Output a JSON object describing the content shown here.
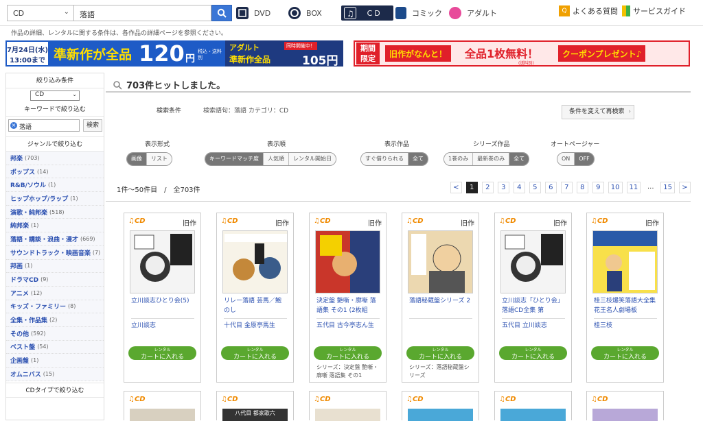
{
  "header": {
    "category_select": "CD",
    "search_value": "落語",
    "nav": [
      {
        "label": "DVD"
      },
      {
        "label": "BOX"
      },
      {
        "label": "ＣＤ"
      },
      {
        "label": "コミック"
      },
      {
        "label": "アダルト"
      }
    ],
    "faq": "よくある質問",
    "guide": "サービスガイド"
  },
  "notice": "作品の詳細、レンタルに関する条件は、各作品の詳細ページを参照ください。",
  "banner1": {
    "date": "7月24日(水)",
    "time": "13:00まで",
    "main": "準新作が全品",
    "price": "120",
    "yen": "円",
    "tax": "税込・送料別",
    "adult": "アダルト",
    "now": "同時開催中！",
    "adult_main": "準新作全品",
    "adult_price": "105円"
  },
  "banner2": {
    "tag1": "期間",
    "tag2": "限定",
    "text1": "旧作がなんと！",
    "text2": "全品1枚無料！",
    "text3": "(送料別)",
    "text4": "クーポンプレゼント♪"
  },
  "sidebar": {
    "filter_title": "絞り込み条件",
    "select": "CD",
    "keyword_title": "キーワードで絞り込む",
    "keyword_value": "落語",
    "keyword_button": "検索",
    "genre_title": "ジャンルで絞り込む",
    "genres": [
      {
        "label": "邦楽",
        "count": "(703)"
      },
      {
        "label": "ポップス",
        "count": "(14)"
      },
      {
        "label": "R&B/ソウル",
        "count": "(1)"
      },
      {
        "label": "ヒップホップ/ラップ",
        "count": "(1)"
      },
      {
        "label": "演歌・純邦楽",
        "count": "(518)"
      },
      {
        "label": "純邦楽",
        "count": "(1)"
      },
      {
        "label": "落語・講談・浪曲・漫才",
        "count": "(669)"
      },
      {
        "label": "サウンドトラック・映画音楽",
        "count": "(7)"
      },
      {
        "label": "邦画",
        "count": "(1)"
      },
      {
        "label": "ドラマCD",
        "count": "(9)"
      },
      {
        "label": "アニメ",
        "count": "(12)"
      },
      {
        "label": "キッズ・ファミリー",
        "count": "(8)"
      },
      {
        "label": "全集・作品集",
        "count": "(2)"
      },
      {
        "label": "その他",
        "count": "(592)"
      },
      {
        "label": "ベスト盤",
        "count": "(54)"
      },
      {
        "label": "企画盤",
        "count": "(1)"
      },
      {
        "label": "オムニバス",
        "count": "(15)"
      }
    ],
    "cdtype_title": "CDタイプで絞り込む"
  },
  "main": {
    "hits": "703件ヒットしました。",
    "cond_label": "検索条件",
    "cond_value": "検索語句：落語 カテゴリ：CD",
    "research_button": "条件を変えて再検索",
    "options": {
      "display_label": "表示形式",
      "display": [
        "画像",
        "リスト"
      ],
      "order_label": "表示順",
      "order": [
        "キーワードマッチ度",
        "人気順",
        "レンタル開始日"
      ],
      "works_label": "表示作品",
      "works": [
        "すぐ借りられる",
        "全て"
      ],
      "series_label": "シリーズ作品",
      "series": [
        "1巻のみ",
        "最新巻のみ",
        "全て"
      ],
      "autopager_label": "オートページャー",
      "autopager": [
        "ON",
        "OFF"
      ]
    },
    "range": "1件～50件目　/　全703件",
    "pager": [
      "<",
      "1",
      "2",
      "3",
      "4",
      "5",
      "6",
      "7",
      "8",
      "9",
      "10",
      "11",
      "...",
      "15",
      ">"
    ]
  },
  "products": [
    {
      "type": "CD",
      "status": "旧作",
      "title": "立川談志ひとり会(5)",
      "artist": "立川談志",
      "cart_small": "レンタル",
      "cart": "カートに入れる",
      "series": ""
    },
    {
      "type": "CD",
      "status": "旧作",
      "title": "リレー落語 芸馬／鮑のし",
      "artist": "十代目 金原亭馬生",
      "cart_small": "レンタル",
      "cart": "カートに入れる",
      "series": ""
    },
    {
      "type": "CD",
      "status": "旧作",
      "title": "決定盤 艶噺・廓噺 落語集 その1 (2枚組",
      "artist": "五代目 古今亭志ん生",
      "cart_small": "レンタル",
      "cart": "カートに入れる",
      "series": "シリーズ：決定盤 艶噺・廓噺 落語集 その1"
    },
    {
      "type": "CD",
      "status": "旧作",
      "title": "落語秘蔵盤シリーズ 2",
      "artist": "",
      "cart_small": "レンタル",
      "cart": "カートに入れる",
      "series": "シリーズ：落語秘蔵盤シリーズ"
    },
    {
      "type": "CD",
      "status": "旧作",
      "title": "立川談志「ひとり会」落語CD全集 第",
      "artist": "五代目 立川談志",
      "cart_small": "レンタル",
      "cart": "カートに入れる",
      "series": ""
    },
    {
      "type": "CD",
      "status": "旧作",
      "title": "桂三枝爆笑落語大全集 花王名人劇場板",
      "artist": "桂三枝",
      "cart_small": "レンタル",
      "cart": "カートに入れる",
      "series": ""
    }
  ],
  "products_row2": [
    {
      "type": "CD"
    },
    {
      "type": "CD",
      "cover_text": "八代目 都家歌六"
    },
    {
      "type": "CD"
    },
    {
      "type": "CD"
    },
    {
      "type": "CD"
    },
    {
      "type": "CD"
    }
  ]
}
